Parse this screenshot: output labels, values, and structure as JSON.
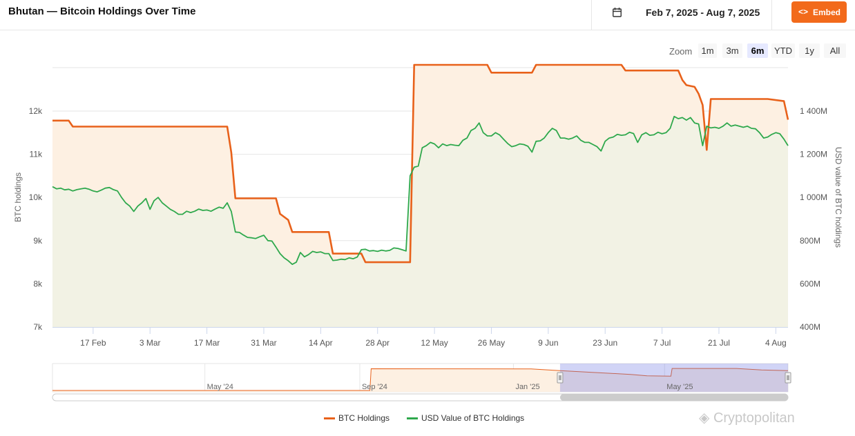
{
  "header": {
    "title": "Bhutan — Bitcoin Holdings Over Time",
    "date_range": "Feb 7, 2025 - Aug 7, 2025",
    "embed_label": "Embed",
    "calendar_icon": "calendar-icon",
    "embed_icon": "code-icon"
  },
  "zoom": {
    "label": "Zoom",
    "options": [
      "1m",
      "3m",
      "6m",
      "YTD",
      "1y",
      "All"
    ],
    "selected": "6m"
  },
  "watermark": "Cryptopolitan",
  "chart_data": {
    "type": "area",
    "x_range": [
      "2025-02-07",
      "2025-08-07"
    ],
    "left_axis": {
      "label": "BTC holdings",
      "ticks": [
        "7k",
        "8k",
        "9k",
        "10k",
        "11k",
        "12k"
      ],
      "range": [
        7000,
        12000
      ]
    },
    "right_axis": {
      "label": "USD value of BTC holdings",
      "ticks": [
        "400M",
        "600M",
        "800M",
        "1 000M",
        "1 200M",
        "1 400M"
      ],
      "range": [
        400,
        1400
      ]
    },
    "x_ticks": [
      "17 Feb",
      "3 Mar",
      "17 Mar",
      "31 Mar",
      "14 Apr",
      "28 Apr",
      "12 May",
      "26 May",
      "9 Jun",
      "23 Jun",
      "7 Jul",
      "21 Jul",
      "4 Aug"
    ],
    "x_tick_dates": [
      "2025-02-17",
      "2025-03-03",
      "2025-03-17",
      "2025-03-31",
      "2025-04-14",
      "2025-04-28",
      "2025-05-12",
      "2025-05-26",
      "2025-06-09",
      "2025-06-23",
      "2025-07-07",
      "2025-07-21",
      "2025-08-04"
    ],
    "legend_position": "bottom",
    "series": [
      {
        "name": "BTC Holdings",
        "axis": "left",
        "color": "#e8611a",
        "fill": "#fdf0e2",
        "points": [
          [
            "2025-02-07",
            11780
          ],
          [
            "2025-02-11",
            11780
          ],
          [
            "2025-02-12",
            11640
          ],
          [
            "2025-03-22",
            11640
          ],
          [
            "2025-03-23",
            11040
          ],
          [
            "2025-03-24",
            9980
          ],
          [
            "2025-04-03",
            9980
          ],
          [
            "2025-04-04",
            9620
          ],
          [
            "2025-04-06",
            9480
          ],
          [
            "2025-04-07",
            9200
          ],
          [
            "2025-04-16",
            9200
          ],
          [
            "2025-04-17",
            8700
          ],
          [
            "2025-04-24",
            8700
          ],
          [
            "2025-04-25",
            8500
          ],
          [
            "2025-05-06",
            8500
          ],
          [
            "2025-05-07",
            13070
          ],
          [
            "2025-05-25",
            13070
          ],
          [
            "2025-05-26",
            12890
          ],
          [
            "2025-06-05",
            12890
          ],
          [
            "2025-06-06",
            13070
          ],
          [
            "2025-06-27",
            13070
          ],
          [
            "2025-06-28",
            12940
          ],
          [
            "2025-07-11",
            12940
          ],
          [
            "2025-07-12",
            12720
          ],
          [
            "2025-07-13",
            12600
          ],
          [
            "2025-07-15",
            12560
          ],
          [
            "2025-07-16",
            12400
          ],
          [
            "2025-07-17",
            12140
          ],
          [
            "2025-07-18",
            11100
          ],
          [
            "2025-07-19",
            12280
          ],
          [
            "2025-08-02",
            12280
          ],
          [
            "2025-08-06",
            12230
          ],
          [
            "2025-08-07",
            11800
          ]
        ]
      },
      {
        "name": "USD Value of BTC Holdings",
        "axis": "right",
        "color": "#2ea84c",
        "fill": "#eef3e4",
        "points": [
          [
            "2025-02-07",
            1050
          ],
          [
            "2025-02-08",
            1040
          ],
          [
            "2025-02-09",
            1043
          ],
          [
            "2025-02-10",
            1035
          ],
          [
            "2025-02-11",
            1038
          ],
          [
            "2025-02-12",
            1030
          ],
          [
            "2025-02-13",
            1036
          ],
          [
            "2025-02-14",
            1040
          ],
          [
            "2025-02-15",
            1043
          ],
          [
            "2025-02-16",
            1038
          ],
          [
            "2025-02-17",
            1030
          ],
          [
            "2025-02-18",
            1026
          ],
          [
            "2025-02-19",
            1034
          ],
          [
            "2025-02-20",
            1043
          ],
          [
            "2025-02-21",
            1046
          ],
          [
            "2025-02-22",
            1036
          ],
          [
            "2025-02-23",
            1030
          ],
          [
            "2025-02-24",
            1000
          ],
          [
            "2025-02-25",
            975
          ],
          [
            "2025-02-26",
            960
          ],
          [
            "2025-02-27",
            935
          ],
          [
            "2025-02-28",
            960
          ],
          [
            "2025-03-01",
            975
          ],
          [
            "2025-03-02",
            995
          ],
          [
            "2025-03-03",
            945
          ],
          [
            "2025-03-04",
            985
          ],
          [
            "2025-03-05",
            1000
          ],
          [
            "2025-03-06",
            975
          ],
          [
            "2025-03-07",
            960
          ],
          [
            "2025-03-08",
            945
          ],
          [
            "2025-03-09",
            935
          ],
          [
            "2025-03-10",
            922
          ],
          [
            "2025-03-11",
            922
          ],
          [
            "2025-03-12",
            936
          ],
          [
            "2025-03-13",
            930
          ],
          [
            "2025-03-14",
            936
          ],
          [
            "2025-03-15",
            946
          ],
          [
            "2025-03-16",
            940
          ],
          [
            "2025-03-17",
            942
          ],
          [
            "2025-03-18",
            936
          ],
          [
            "2025-03-19",
            946
          ],
          [
            "2025-03-20",
            955
          ],
          [
            "2025-03-21",
            950
          ],
          [
            "2025-03-22",
            975
          ],
          [
            "2025-03-23",
            935
          ],
          [
            "2025-03-24",
            840
          ],
          [
            "2025-03-25",
            838
          ],
          [
            "2025-03-26",
            826
          ],
          [
            "2025-03-27",
            815
          ],
          [
            "2025-03-28",
            813
          ],
          [
            "2025-03-29",
            810
          ],
          [
            "2025-03-30",
            818
          ],
          [
            "2025-03-31",
            825
          ],
          [
            "2025-04-01",
            800
          ],
          [
            "2025-04-02",
            798
          ],
          [
            "2025-04-03",
            770
          ],
          [
            "2025-04-04",
            740
          ],
          [
            "2025-04-05",
            720
          ],
          [
            "2025-04-06",
            707
          ],
          [
            "2025-04-07",
            690
          ],
          [
            "2025-04-08",
            700
          ],
          [
            "2025-04-09",
            745
          ],
          [
            "2025-04-10",
            725
          ],
          [
            "2025-04-11",
            735
          ],
          [
            "2025-04-12",
            750
          ],
          [
            "2025-04-13",
            745
          ],
          [
            "2025-04-14",
            748
          ],
          [
            "2025-04-15",
            740
          ],
          [
            "2025-04-16",
            740
          ],
          [
            "2025-04-17",
            708
          ],
          [
            "2025-04-18",
            710
          ],
          [
            "2025-04-19",
            714
          ],
          [
            "2025-04-20",
            712
          ],
          [
            "2025-04-21",
            720
          ],
          [
            "2025-04-22",
            716
          ],
          [
            "2025-04-23",
            724
          ],
          [
            "2025-04-24",
            758
          ],
          [
            "2025-04-25",
            760
          ],
          [
            "2025-04-26",
            752
          ],
          [
            "2025-04-27",
            754
          ],
          [
            "2025-04-28",
            750
          ],
          [
            "2025-04-29",
            756
          ],
          [
            "2025-04-30",
            752
          ],
          [
            "2025-05-01",
            755
          ],
          [
            "2025-05-02",
            766
          ],
          [
            "2025-05-03",
            764
          ],
          [
            "2025-05-04",
            758
          ],
          [
            "2025-05-05",
            752
          ],
          [
            "2025-05-06",
            1100
          ],
          [
            "2025-05-07",
            1140
          ],
          [
            "2025-05-08",
            1145
          ],
          [
            "2025-05-09",
            1230
          ],
          [
            "2025-05-10",
            1240
          ],
          [
            "2025-05-11",
            1255
          ],
          [
            "2025-05-12",
            1248
          ],
          [
            "2025-05-13",
            1230
          ],
          [
            "2025-05-14",
            1248
          ],
          [
            "2025-05-15",
            1240
          ],
          [
            "2025-05-16",
            1245
          ],
          [
            "2025-05-17",
            1242
          ],
          [
            "2025-05-18",
            1240
          ],
          [
            "2025-05-19",
            1265
          ],
          [
            "2025-05-20",
            1275
          ],
          [
            "2025-05-21",
            1310
          ],
          [
            "2025-05-22",
            1320
          ],
          [
            "2025-05-23",
            1345
          ],
          [
            "2025-05-24",
            1300
          ],
          [
            "2025-05-25",
            1285
          ],
          [
            "2025-05-26",
            1285
          ],
          [
            "2025-05-27",
            1300
          ],
          [
            "2025-05-28",
            1290
          ],
          [
            "2025-05-29",
            1270
          ],
          [
            "2025-05-30",
            1250
          ],
          [
            "2025-05-31",
            1235
          ],
          [
            "2025-06-01",
            1240
          ],
          [
            "2025-06-02",
            1248
          ],
          [
            "2025-06-03",
            1245
          ],
          [
            "2025-06-04",
            1237
          ],
          [
            "2025-06-05",
            1210
          ],
          [
            "2025-06-06",
            1260
          ],
          [
            "2025-06-07",
            1262
          ],
          [
            "2025-06-08",
            1275
          ],
          [
            "2025-06-09",
            1300
          ],
          [
            "2025-06-10",
            1320
          ],
          [
            "2025-06-11",
            1310
          ],
          [
            "2025-06-12",
            1275
          ],
          [
            "2025-06-13",
            1275
          ],
          [
            "2025-06-14",
            1270
          ],
          [
            "2025-06-15",
            1275
          ],
          [
            "2025-06-16",
            1285
          ],
          [
            "2025-06-17",
            1265
          ],
          [
            "2025-06-18",
            1255
          ],
          [
            "2025-06-19",
            1255
          ],
          [
            "2025-06-20",
            1245
          ],
          [
            "2025-06-21",
            1235
          ],
          [
            "2025-06-22",
            1215
          ],
          [
            "2025-06-23",
            1260
          ],
          [
            "2025-06-24",
            1275
          ],
          [
            "2025-06-25",
            1280
          ],
          [
            "2025-06-26",
            1292
          ],
          [
            "2025-06-27",
            1288
          ],
          [
            "2025-06-28",
            1290
          ],
          [
            "2025-06-29",
            1302
          ],
          [
            "2025-06-30",
            1296
          ],
          [
            "2025-07-01",
            1255
          ],
          [
            "2025-07-02",
            1290
          ],
          [
            "2025-07-03",
            1300
          ],
          [
            "2025-07-04",
            1288
          ],
          [
            "2025-07-05",
            1290
          ],
          [
            "2025-07-06",
            1302
          ],
          [
            "2025-07-07",
            1295
          ],
          [
            "2025-07-08",
            1300
          ],
          [
            "2025-07-09",
            1320
          ],
          [
            "2025-07-10",
            1375
          ],
          [
            "2025-07-11",
            1365
          ],
          [
            "2025-07-12",
            1370
          ],
          [
            "2025-07-13",
            1358
          ],
          [
            "2025-07-14",
            1370
          ],
          [
            "2025-07-15",
            1345
          ],
          [
            "2025-07-16",
            1340
          ],
          [
            "2025-07-17",
            1240
          ],
          [
            "2025-07-18",
            1330
          ],
          [
            "2025-07-19",
            1322
          ],
          [
            "2025-07-20",
            1325
          ],
          [
            "2025-07-21",
            1320
          ],
          [
            "2025-07-22",
            1330
          ],
          [
            "2025-07-23",
            1345
          ],
          [
            "2025-07-24",
            1330
          ],
          [
            "2025-07-25",
            1335
          ],
          [
            "2025-07-26",
            1330
          ],
          [
            "2025-07-27",
            1325
          ],
          [
            "2025-07-28",
            1330
          ],
          [
            "2025-07-29",
            1320
          ],
          [
            "2025-07-30",
            1318
          ],
          [
            "2025-07-31",
            1300
          ],
          [
            "2025-08-01",
            1275
          ],
          [
            "2025-08-02",
            1280
          ],
          [
            "2025-08-03",
            1292
          ],
          [
            "2025-08-04",
            1300
          ],
          [
            "2025-08-05",
            1295
          ],
          [
            "2025-08-06",
            1270
          ],
          [
            "2025-08-07",
            1240
          ]
        ]
      }
    ],
    "navigator": {
      "labels": [
        "May '24",
        "Sep '24",
        "Jan '25",
        "May '25"
      ],
      "label_dates": [
        "2024-05-01",
        "2024-09-01",
        "2025-01-01",
        "2025-05-01"
      ],
      "range": [
        "2024-01-01",
        "2025-08-07"
      ],
      "selected": [
        "2025-02-07",
        "2025-08-07"
      ],
      "points": [
        [
          "2024-01-01",
          0
        ],
        [
          "2024-09-09",
          0
        ],
        [
          "2024-09-10",
          12900
        ],
        [
          "2024-11-15",
          12860
        ],
        [
          "2025-01-15",
          12780
        ],
        [
          "2025-02-07",
          11780
        ],
        [
          "2025-03-24",
          9980
        ],
        [
          "2025-04-04",
          9480
        ],
        [
          "2025-04-17",
          8700
        ],
        [
          "2025-05-06",
          8500
        ],
        [
          "2025-05-07",
          13070
        ],
        [
          "2025-06-27",
          13070
        ],
        [
          "2025-07-17",
          12140
        ],
        [
          "2025-08-07",
          11800
        ]
      ]
    }
  }
}
